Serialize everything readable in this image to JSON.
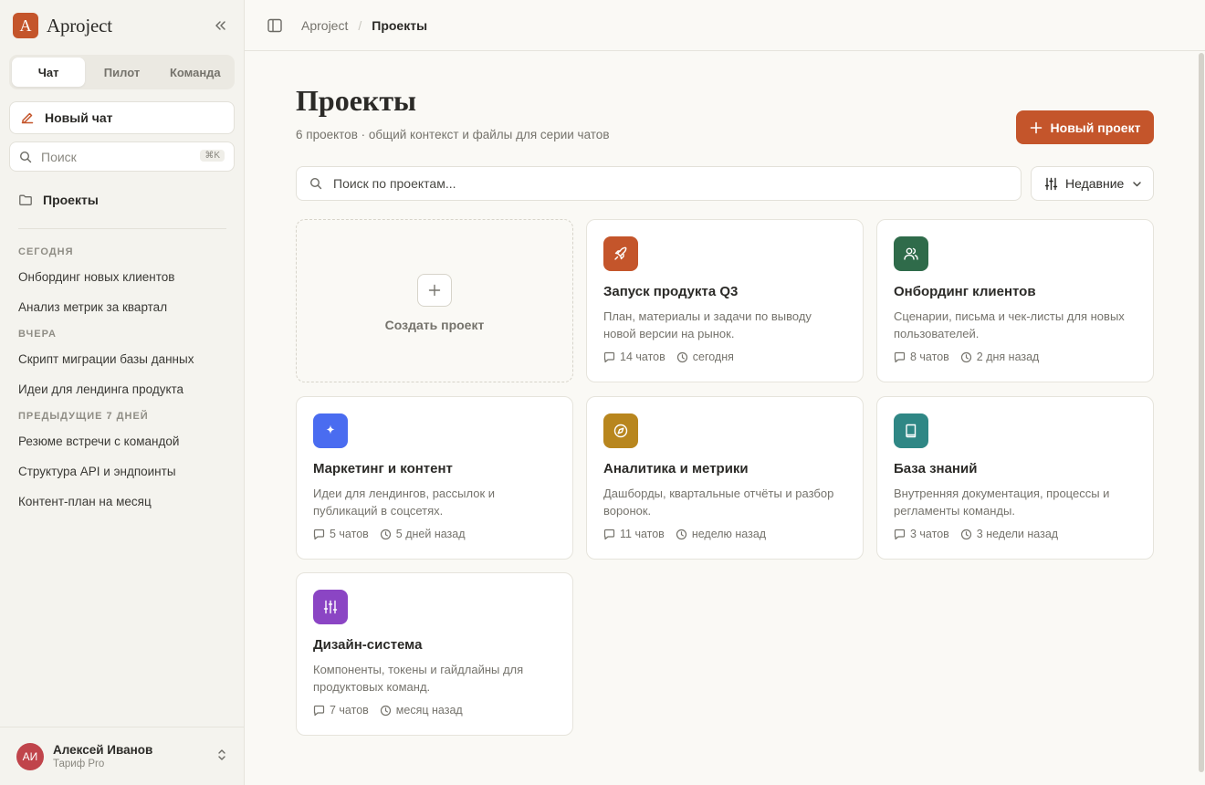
{
  "sidebar": {
    "brand": {
      "letter": "A",
      "name": "Aproject"
    },
    "mode_tabs": [
      {
        "label": "Чат",
        "active": true
      },
      {
        "label": "Пилот",
        "active": false
      },
      {
        "label": "Команда",
        "active": false
      }
    ],
    "new_chat_label": "Новый чат",
    "search": {
      "placeholder": "Поиск",
      "shortcut": "⌘K"
    },
    "projects_label": "Проекты",
    "history": {
      "today": {
        "label": "СЕГОДНЯ",
        "items": [
          "Онбординг новых клиентов",
          "Анализ метрик за квартал"
        ]
      },
      "yesterday": {
        "label": "ВЧЕРА",
        "items": [
          "Скрипт миграции базы данных",
          "Идеи для лендинга продукта"
        ]
      },
      "week": {
        "label": "ПРЕДЫДУЩИЕ 7 ДНЕЙ",
        "items": [
          "Резюме встречи с командой",
          "Структура API и эндпоинты",
          "Контент-план на месяц"
        ]
      }
    },
    "user": {
      "initials": "АИ",
      "name": "Алексей Иванов",
      "plan": "Тариф Pro"
    }
  },
  "header": {
    "breadcrumb": {
      "root": "Aproject",
      "separator": "/",
      "current": "Проекты"
    }
  },
  "main": {
    "title": "Проекты",
    "subtitle": "6 проектов · общий контекст и файлы для серии чатов",
    "new_project_label": "Новый проект",
    "search_placeholder": "Поиск по проектам...",
    "sort_label": "Недавние",
    "create_label": "Создать проект",
    "projects": [
      {
        "title": "Запуск продукта Q3",
        "desc": "План, материалы и задачи по выводу новой версии на рынок.",
        "chats": "14 чатов",
        "updated": "сегодня",
        "icon": "rocket-icon",
        "color": "#c4552b"
      },
      {
        "title": "Онбординг клиентов",
        "desc": "Сценарии, письма и чек-листы для новых пользователей.",
        "chats": "8 чатов",
        "updated": "2 дня назад",
        "icon": "users-icon",
        "color": "#2f6b4a"
      },
      {
        "title": "Маркетинг и контент",
        "desc": "Идеи для лендингов, рассылок и публикаций в соцсетях.",
        "chats": "5 чатов",
        "updated": "5 дней назад",
        "icon": "sparkle-icon",
        "color": "#4a6cf0"
      },
      {
        "title": "Аналитика и метрики",
        "desc": "Дашборды, квартальные отчёты и разбор воронок.",
        "chats": "11 чатов",
        "updated": "неделю назад",
        "icon": "compass-icon",
        "color": "#b8861e"
      },
      {
        "title": "База знаний",
        "desc": "Внутренняя документация, процессы и регламенты команды.",
        "chats": "3 чатов",
        "updated": "3 недели назад",
        "icon": "book-icon",
        "color": "#2f8785"
      },
      {
        "title": "Дизайн-система",
        "desc": "Компоненты, токены и гайдлайны для продуктовых команд.",
        "chats": "7 чатов",
        "updated": "месяц назад",
        "icon": "sliders-icon",
        "color": "#8b45c4"
      }
    ]
  }
}
